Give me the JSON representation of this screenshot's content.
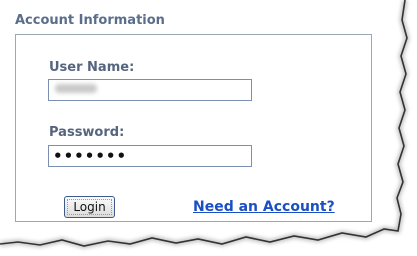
{
  "form": {
    "section_title": "Account Information",
    "username_label": "User Name:",
    "username_value": "",
    "password_label": "Password:",
    "password_value": "•••••••",
    "login_button_label": "Login",
    "signup_link_label": "Need an Account?"
  },
  "colors": {
    "label_text": "#55657e",
    "link": "#1a4fc4",
    "field_border": "#7a8fb2"
  }
}
